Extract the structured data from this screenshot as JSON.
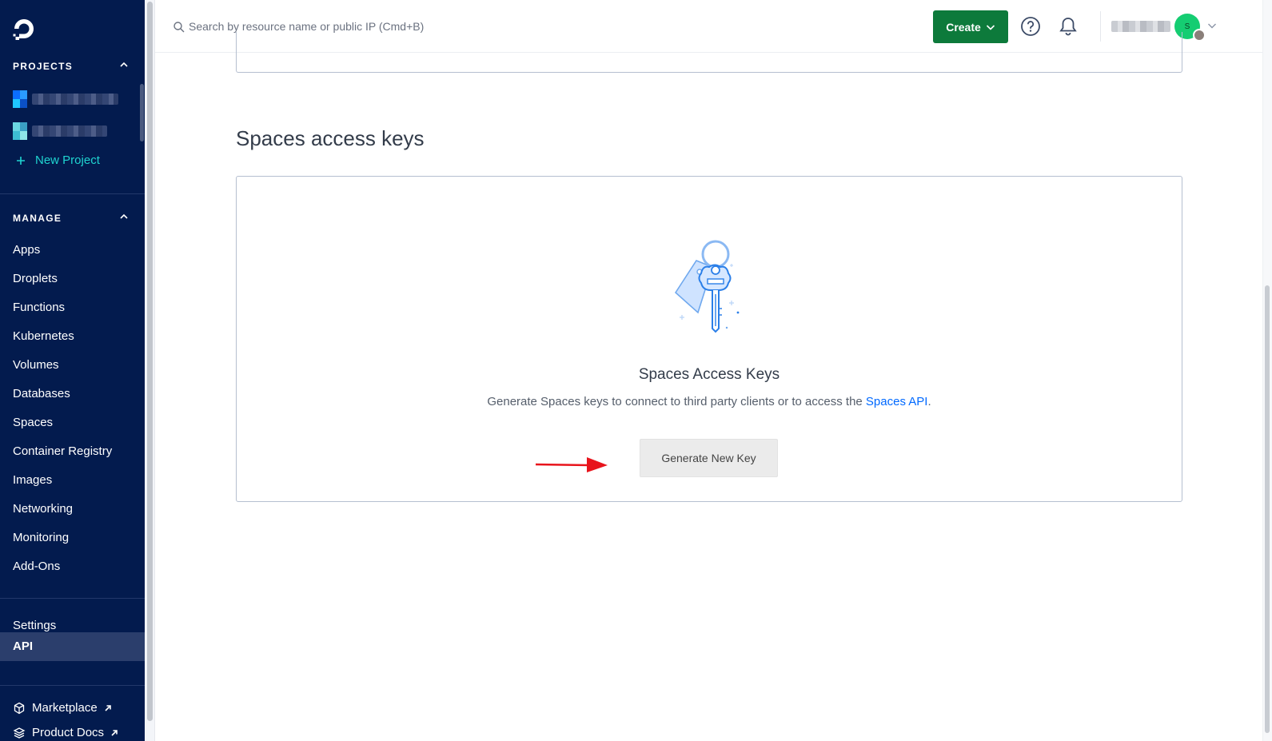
{
  "sidebar": {
    "projects_heading": "PROJECTS",
    "new_project_label": "New Project",
    "manage_heading": "MANAGE",
    "manage_items": [
      "Apps",
      "Droplets",
      "Functions",
      "Kubernetes",
      "Volumes",
      "Databases",
      "Spaces",
      "Container Registry",
      "Images",
      "Networking",
      "Monitoring",
      "Add-Ons"
    ],
    "settings_label": "Settings",
    "api_label": "API",
    "marketplace_label": "Marketplace",
    "product_docs_label": "Product Docs"
  },
  "header": {
    "search_placeholder": "Search by resource name or public IP (Cmd+B)",
    "create_label": "Create",
    "avatar_initial": "S"
  },
  "main": {
    "section_title": "Spaces access keys",
    "card_title": "Spaces Access Keys",
    "card_desc_prefix": "Generate Spaces keys to connect to third party clients or to access the ",
    "card_desc_link": "Spaces API",
    "card_desc_suffix": ".",
    "generate_button_label": "Generate New Key"
  },
  "colors": {
    "sidebar_bg": "#031b4e",
    "accent_teal": "#1fd4d0",
    "create_green": "#0d7a3b",
    "link_blue": "#0069ff",
    "annotation_red": "#e8141c"
  }
}
